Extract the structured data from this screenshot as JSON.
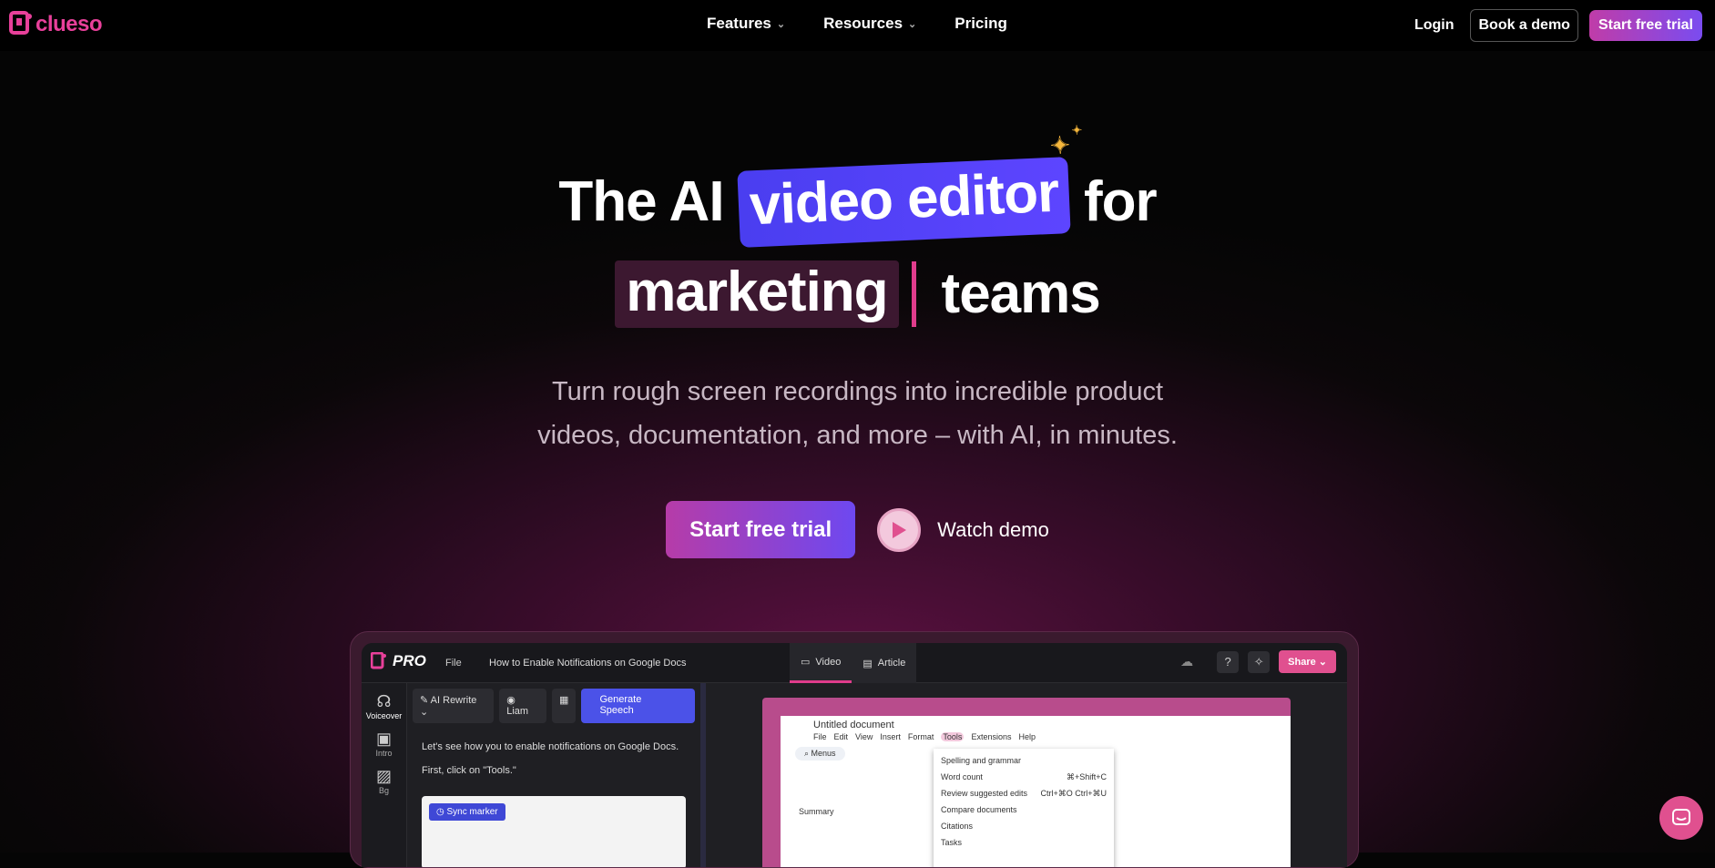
{
  "brand": {
    "name": "clueso",
    "color": "#e8409a"
  },
  "nav": {
    "items": [
      {
        "label": "Features",
        "has_dropdown": true
      },
      {
        "label": "Resources",
        "has_dropdown": true
      },
      {
        "label": "Pricing",
        "has_dropdown": false
      }
    ],
    "login": "Login",
    "book_demo": "Book a demo",
    "start_trial": "Start free trial"
  },
  "hero": {
    "title_part1": "The AI",
    "title_highlight": "video editor",
    "title_part2": "for",
    "title_word3": "marketing",
    "title_word4": "teams",
    "subtitle_line1": "Turn rough screen recordings into incredible product",
    "subtitle_line2": "videos, documentation, and more – with AI, in minutes.",
    "cta_primary": "Start free trial",
    "cta_secondary": "Watch demo"
  },
  "app": {
    "plan": "PRO",
    "file_menu": "File",
    "doc_title": "How to Enable Notifications on Google Docs",
    "tabs": [
      {
        "label": "Video",
        "active": true
      },
      {
        "label": "Article",
        "active": false
      }
    ],
    "share": "Share",
    "sidebar": [
      {
        "label": "Voiceover",
        "icon": "voiceover-icon"
      },
      {
        "label": "Intro",
        "icon": "intro-icon"
      },
      {
        "label": "Bg",
        "icon": "background-icon"
      }
    ],
    "toolbar": {
      "rewrite": "AI Rewrite",
      "voice": "Liam",
      "generate": "Generate Speech"
    },
    "script": [
      "Let's see how you to enable notifications on Google Docs.",
      "First, click on \"Tools.\""
    ],
    "sync_marker": "Sync marker",
    "gdoc": {
      "title": "Untitled document",
      "menu": [
        "File",
        "Edit",
        "View",
        "Insert",
        "Format",
        "Tools",
        "Extensions",
        "Help"
      ],
      "search": "Menus",
      "summary": "Summary",
      "tools_menu": [
        {
          "label": "Spelling and grammar",
          "shortcut": ""
        },
        {
          "label": "Word count",
          "shortcut": "⌘+Shift+C"
        },
        {
          "label": "Review suggested edits",
          "shortcut": "Ctrl+⌘O Ctrl+⌘U"
        },
        {
          "label": "Compare documents",
          "shortcut": ""
        },
        {
          "label": "Citations",
          "shortcut": ""
        },
        {
          "label": "Tasks",
          "shortcut": ""
        }
      ]
    }
  }
}
